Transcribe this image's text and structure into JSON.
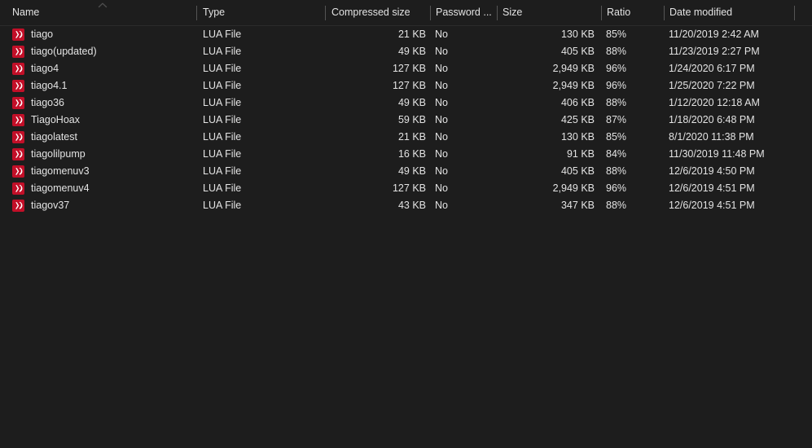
{
  "view": {
    "name": "file-list-details-view",
    "background_color": "#1d1d1d",
    "text_color": "#e3e3e3",
    "icon_color": "#c20f28",
    "sort_column": "Name",
    "sort_direction": "ascending"
  },
  "columns": [
    {
      "key": "name",
      "label": "Name",
      "align": "left"
    },
    {
      "key": "type",
      "label": "Type",
      "align": "left"
    },
    {
      "key": "compressed_size",
      "label": "Compressed size",
      "align": "right"
    },
    {
      "key": "password",
      "label": "Password ...",
      "align": "left"
    },
    {
      "key": "size",
      "label": "Size",
      "align": "right"
    },
    {
      "key": "ratio",
      "label": "Ratio",
      "align": "left"
    },
    {
      "key": "date_modified",
      "label": "Date modified",
      "align": "left"
    }
  ],
  "rows": [
    {
      "icon": "lua-file-icon",
      "name": "tiago",
      "type": "LUA File",
      "compressed_size": "21 KB",
      "password": "No",
      "size": "130 KB",
      "ratio": "85%",
      "date_modified": "11/20/2019 2:42 AM"
    },
    {
      "icon": "lua-file-icon",
      "name": "tiago(updated)",
      "type": "LUA File",
      "compressed_size": "49 KB",
      "password": "No",
      "size": "405 KB",
      "ratio": "88%",
      "date_modified": "11/23/2019 2:27 PM"
    },
    {
      "icon": "lua-file-icon",
      "name": "tiago4",
      "type": "LUA File",
      "compressed_size": "127 KB",
      "password": "No",
      "size": "2,949 KB",
      "ratio": "96%",
      "date_modified": "1/24/2020 6:17 PM"
    },
    {
      "icon": "lua-file-icon",
      "name": "tiago4.1",
      "type": "LUA File",
      "compressed_size": "127 KB",
      "password": "No",
      "size": "2,949 KB",
      "ratio": "96%",
      "date_modified": "1/25/2020 7:22 PM"
    },
    {
      "icon": "lua-file-icon",
      "name": "tiago36",
      "type": "LUA File",
      "compressed_size": "49 KB",
      "password": "No",
      "size": "406 KB",
      "ratio": "88%",
      "date_modified": "1/12/2020 12:18 AM"
    },
    {
      "icon": "lua-file-icon",
      "name": "TiagoHoax",
      "type": "LUA File",
      "compressed_size": "59 KB",
      "password": "No",
      "size": "425 KB",
      "ratio": "87%",
      "date_modified": "1/18/2020 6:48 PM"
    },
    {
      "icon": "lua-file-icon",
      "name": "tiagolatest",
      "type": "LUA File",
      "compressed_size": "21 KB",
      "password": "No",
      "size": "130 KB",
      "ratio": "85%",
      "date_modified": "8/1/2020 11:38 PM"
    },
    {
      "icon": "lua-file-icon",
      "name": "tiagolilpump",
      "type": "LUA File",
      "compressed_size": "16 KB",
      "password": "No",
      "size": "91 KB",
      "ratio": "84%",
      "date_modified": "11/30/2019 11:48 PM"
    },
    {
      "icon": "lua-file-icon",
      "name": "tiagomenuv3",
      "type": "LUA File",
      "compressed_size": "49 KB",
      "password": "No",
      "size": "405 KB",
      "ratio": "88%",
      "date_modified": "12/6/2019 4:50 PM"
    },
    {
      "icon": "lua-file-icon",
      "name": "tiagomenuv4",
      "type": "LUA File",
      "compressed_size": "127 KB",
      "password": "No",
      "size": "2,949 KB",
      "ratio": "96%",
      "date_modified": "12/6/2019 4:51 PM"
    },
    {
      "icon": "lua-file-icon",
      "name": "tiagov37",
      "type": "LUA File",
      "compressed_size": "43 KB",
      "password": "No",
      "size": "347 KB",
      "ratio": "88%",
      "date_modified": "12/6/2019 4:51 PM"
    }
  ]
}
